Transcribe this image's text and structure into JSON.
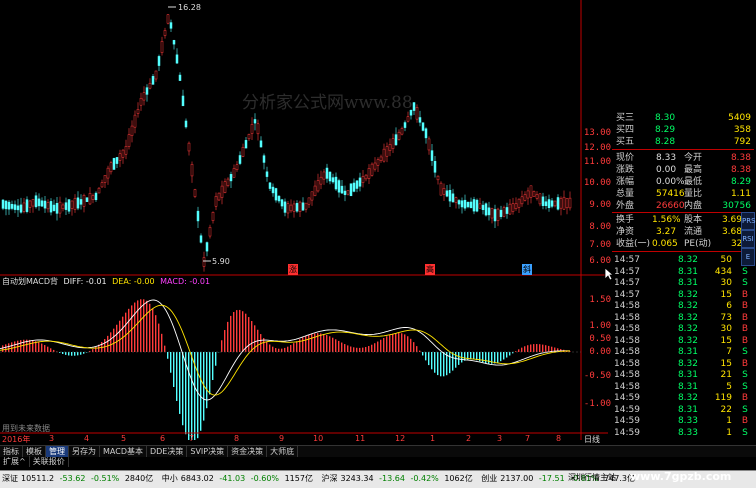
{
  "watermark": "分析家公式网www.88",
  "site_watermark": "www.7gpzb.com",
  "price_chart": {
    "high_label": "16.28",
    "low_label": "5.90",
    "y_ticks": [
      "13.00",
      "12.00",
      "11.00",
      "10.00",
      "9.00",
      "8.00",
      "7.00",
      "6.00"
    ],
    "markers": [
      "涨",
      "高",
      "斜"
    ]
  },
  "macd_header": {
    "name": "自动划MACD背",
    "diff": "DIFF: -0.01",
    "dea": "DEA: -0.00",
    "macd": "MACD: -0.01"
  },
  "macd_ticks": [
    "1.50",
    "1.00",
    "0.50",
    "0.00",
    "-0.50",
    "-1.00"
  ],
  "bottom_note": "用到未来数据",
  "x_axis": [
    "2016年",
    "3",
    "4",
    "5",
    "6",
    "7",
    "8",
    "9",
    "10",
    "11",
    "12",
    "1",
    "2",
    "3",
    "7",
    "8"
  ],
  "x_axis_right": "日线",
  "order_book": [
    {
      "label": "买三",
      "price": "8.30",
      "vol": "5409"
    },
    {
      "label": "买四",
      "price": "8.29",
      "vol": "358"
    },
    {
      "label": "买五",
      "price": "8.28",
      "vol": "792"
    }
  ],
  "quote": [
    {
      "l1": "现价",
      "v1": "8.33",
      "l2": "今开",
      "v2": "8.38"
    },
    {
      "l1": "涨跌",
      "v1": "0.00",
      "l2": "最高",
      "v2": "8.38"
    },
    {
      "l1": "涨幅",
      "v1": "0.00%",
      "l2": "最低",
      "v2": "8.29"
    },
    {
      "l1": "总量",
      "v1": "57416",
      "l2": "量比",
      "v2": "1.11"
    },
    {
      "l1": "外盘",
      "v1": "26660",
      "l2": "内盘",
      "v2": "30756"
    },
    {
      "l1": "换手",
      "v1": "1.56%",
      "l2": "股本",
      "v2": "3.69亿"
    },
    {
      "l1": "净资",
      "v1": "3.27",
      "l2": "流通",
      "v2": "3.68亿"
    },
    {
      "l1": "收益(一)",
      "v1": "0.065",
      "l2": "PE(动)",
      "v2": "32.2"
    }
  ],
  "ticks": [
    {
      "t": "14:57",
      "p": "8.32",
      "v": "50",
      "s": "S"
    },
    {
      "t": "14:57",
      "p": "8.31",
      "v": "434",
      "s": "S"
    },
    {
      "t": "14:57",
      "p": "8.31",
      "v": "30",
      "s": "S"
    },
    {
      "t": "14:57",
      "p": "8.32",
      "v": "15",
      "s": "B"
    },
    {
      "t": "14:58",
      "p": "8.32",
      "v": "6",
      "s": "B"
    },
    {
      "t": "14:58",
      "p": "8.32",
      "v": "73",
      "s": "B"
    },
    {
      "t": "14:58",
      "p": "8.32",
      "v": "30",
      "s": "B"
    },
    {
      "t": "14:58",
      "p": "8.32",
      "v": "15",
      "s": "B"
    },
    {
      "t": "14:58",
      "p": "8.31",
      "v": "7",
      "s": "S"
    },
    {
      "t": "14:58",
      "p": "8.32",
      "v": "15",
      "s": "B"
    },
    {
      "t": "14:58",
      "p": "8.31",
      "v": "21",
      "s": "S"
    },
    {
      "t": "14:58",
      "p": "8.31",
      "v": "5",
      "s": "S"
    },
    {
      "t": "14:59",
      "p": "8.32",
      "v": "119",
      "s": "B"
    },
    {
      "t": "14:59",
      "p": "8.31",
      "v": "22",
      "s": "S"
    },
    {
      "t": "14:59",
      "p": "8.33",
      "v": "1",
      "s": "B"
    },
    {
      "t": "14:59",
      "p": "8.33",
      "v": "1",
      "s": "S"
    }
  ],
  "tabs": [
    "指标",
    "模板",
    "管理",
    "另存为",
    "MACD基本",
    "DDE决策",
    "SVIP决策",
    "资金决策",
    "大师底"
  ],
  "tab_row2": [
    "扩展^",
    "关联报价"
  ],
  "status": [
    {
      "n": "深证",
      "v": "10511.2",
      "c": "-53.62",
      "p": "-0.51%",
      "a": "2840亿"
    },
    {
      "n": "中小",
      "v": "6843.02",
      "c": "-41.03",
      "p": "-0.60%",
      "a": "1157亿"
    },
    {
      "n": "沪深",
      "v": "3243.34",
      "c": "-13.64",
      "p": "-0.42%",
      "a": "1062亿"
    },
    {
      "n": "创业",
      "v": "2137.00",
      "c": "-17.51",
      "p": "-0.81%",
      "a": "747.3亿"
    }
  ],
  "status_tail": "深圳行情主站",
  "side_icons": [
    "PRS",
    "RSI",
    "E"
  ]
}
